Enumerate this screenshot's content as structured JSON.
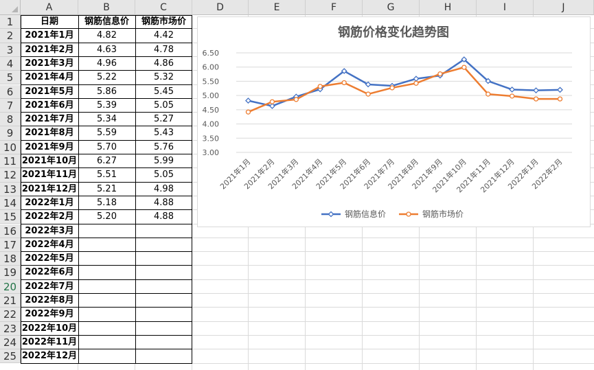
{
  "columns": [
    "A",
    "B",
    "C",
    "D",
    "E",
    "F",
    "G",
    "H",
    "I",
    "J"
  ],
  "rows": [
    "1",
    "2",
    "3",
    "4",
    "5",
    "6",
    "7",
    "8",
    "9",
    "10",
    "11",
    "12",
    "13",
    "14",
    "15",
    "16",
    "17",
    "18",
    "19",
    "20",
    "21",
    "22",
    "23",
    "24",
    "25"
  ],
  "table": {
    "headers": [
      "日期",
      "钢筋信息价",
      "钢筋市场价"
    ],
    "rows": [
      [
        "2021年1月",
        "4.82",
        "4.42"
      ],
      [
        "2021年2月",
        "4.63",
        "4.78"
      ],
      [
        "2021年3月",
        "4.96",
        "4.86"
      ],
      [
        "2021年4月",
        "5.22",
        "5.32"
      ],
      [
        "2021年5月",
        "5.86",
        "5.45"
      ],
      [
        "2021年6月",
        "5.39",
        "5.05"
      ],
      [
        "2021年7月",
        "5.34",
        "5.27"
      ],
      [
        "2021年8月",
        "5.59",
        "5.43"
      ],
      [
        "2021年9月",
        "5.70",
        "5.76"
      ],
      [
        "2021年10月",
        "6.27",
        "5.99"
      ],
      [
        "2021年11月",
        "5.51",
        "5.05"
      ],
      [
        "2021年12月",
        "5.21",
        "4.98"
      ],
      [
        "2022年1月",
        "5.18",
        "4.88"
      ],
      [
        "2022年2月",
        "5.20",
        "4.88"
      ],
      [
        "2022年3月",
        "",
        ""
      ],
      [
        "2022年4月",
        "",
        ""
      ],
      [
        "2022年5月",
        "",
        ""
      ],
      [
        "2022年6月",
        "",
        ""
      ],
      [
        "2022年7月",
        "",
        ""
      ],
      [
        "2022年8月",
        "",
        ""
      ],
      [
        "2022年9月",
        "",
        ""
      ],
      [
        "2022年10月",
        "",
        ""
      ],
      [
        "2022年11月",
        "",
        ""
      ],
      [
        "2022年12月",
        "",
        ""
      ]
    ]
  },
  "chart_data": {
    "type": "line",
    "title": "钢筋价格变化趋势图",
    "categories": [
      "2021年1月",
      "2021年2月",
      "2021年3月",
      "2021年4月",
      "2021年5月",
      "2021年6月",
      "2021年7月",
      "2021年8月",
      "2021年9月",
      "2021年10月",
      "2021年11月",
      "2021年12月",
      "2022年1月",
      "2022年2月"
    ],
    "series": [
      {
        "name": "钢筋信息价",
        "color": "#4472c4",
        "marker": "diamond",
        "values": [
          4.82,
          4.63,
          4.96,
          5.22,
          5.86,
          5.39,
          5.34,
          5.59,
          5.7,
          6.27,
          5.51,
          5.21,
          5.18,
          5.2
        ]
      },
      {
        "name": "钢筋市场价",
        "color": "#ed7d31",
        "marker": "circle",
        "values": [
          4.42,
          4.78,
          4.86,
          5.32,
          5.45,
          5.05,
          5.27,
          5.43,
          5.76,
          5.99,
          5.05,
          4.98,
          4.88,
          4.88
        ]
      }
    ],
    "yticks": [
      "3.00",
      "3.50",
      "4.00",
      "4.50",
      "5.00",
      "5.50",
      "6.00",
      "6.50"
    ],
    "ylim": [
      3.0,
      6.5
    ],
    "grid": true,
    "legend": "bottom"
  }
}
